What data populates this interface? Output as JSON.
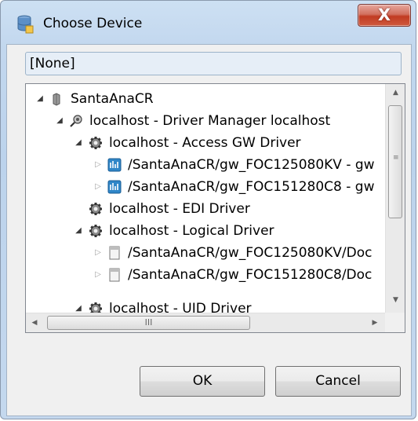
{
  "window": {
    "title": "Choose Device",
    "close_label": "X"
  },
  "selected_device": "[None]",
  "tree": {
    "items": [
      {
        "label": "SantaAnaCR",
        "icon": "cylinder-icon",
        "expander": "expanded"
      },
      {
        "label": "localhost - Driver Manager localhost",
        "icon": "plug-icon",
        "expander": "expanded"
      },
      {
        "label": "localhost - Access GW Driver",
        "icon": "gear-icon",
        "expander": "expanded"
      },
      {
        "label": "/SantaAnaCR/gw_FOC125080KV - gw",
        "icon": "device-icon",
        "expander": "collapsed"
      },
      {
        "label": "/SantaAnaCR/gw_FOC151280C8 - gw",
        "icon": "device-icon",
        "expander": "collapsed"
      },
      {
        "label": "localhost - EDI Driver",
        "icon": "gear-icon",
        "expander": "none"
      },
      {
        "label": "localhost - Logical Driver",
        "icon": "gear-icon",
        "expander": "expanded"
      },
      {
        "label": "/SantaAnaCR/gw_FOC125080KV/Doc",
        "icon": "document-icon",
        "expander": "collapsed"
      },
      {
        "label": "/SantaAnaCR/gw_FOC151280C8/Doc",
        "icon": "document-icon",
        "expander": "collapsed"
      },
      {
        "label": "localhost - UID Driver",
        "icon": "gear-icon",
        "expander": "expanded"
      }
    ]
  },
  "scrollbar": {
    "h_thumb_grip": "III",
    "v_thumb_grip": "≡"
  },
  "buttons": {
    "ok": "OK",
    "cancel": "Cancel"
  },
  "colors": {
    "window_frame": "#c2d7ee",
    "close_button": "#c13b22",
    "selection_field_bg": "#e6eef7",
    "device_icon": "#2f86c8"
  }
}
